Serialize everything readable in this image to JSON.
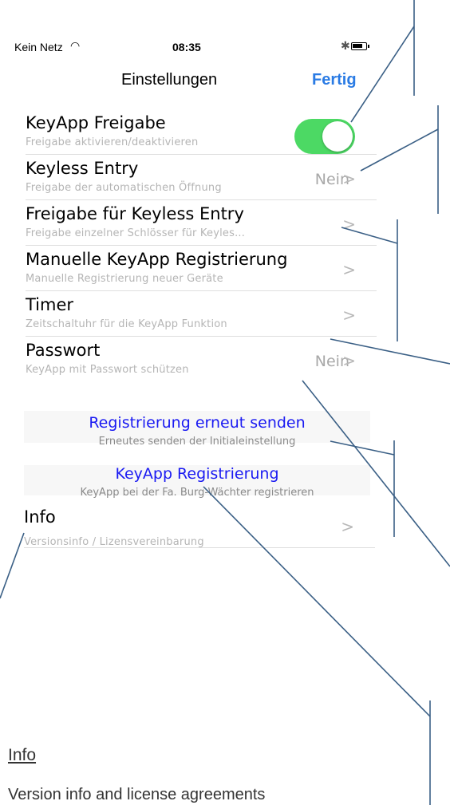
{
  "status_bar": {
    "carrier": "Kein Netz",
    "time": "08:35"
  },
  "nav": {
    "title": "Einstellungen",
    "done_label": "Fertig"
  },
  "rows": [
    {
      "title": "KeyApp Freigabe",
      "subtitle": "Freigabe aktivieren/deaktivieren",
      "toggle_on": true
    },
    {
      "title": "Keyless Entry",
      "subtitle": "Freigabe der automatischen Öffnung",
      "value": "Nein"
    },
    {
      "title": "Freigabe für Keyless Entry",
      "subtitle": "Freigabe einzelner Schlösser für Keyles..."
    },
    {
      "title": "Manuelle KeyApp Registrierung",
      "subtitle": "Manuelle Registrierung neuer Geräte"
    },
    {
      "title": "Timer",
      "subtitle": "Zeitschaltuhr für die KeyApp Funktion"
    },
    {
      "title": "Passwort",
      "subtitle": "KeyApp mit Passwort schützen",
      "value": "Nein"
    }
  ],
  "actions": [
    {
      "title": "Registrierung erneut senden",
      "subtitle": "Erneutes senden der Initialeinstellung"
    },
    {
      "title": "KeyApp Registrierung",
      "subtitle": "KeyApp bei der Fa. Burg-Wächter registrieren"
    }
  ],
  "info_row": {
    "title": "Info",
    "subtitle": "Versionsinfo / Lizensvereinbarung"
  },
  "caption": {
    "title": "Info",
    "text": "Version info and license agreements"
  },
  "colors": {
    "accent": "#2a7be4",
    "toggle_on": "#4cd964",
    "action_text": "#1a1af2",
    "annotation_line": "#3a5f85"
  }
}
